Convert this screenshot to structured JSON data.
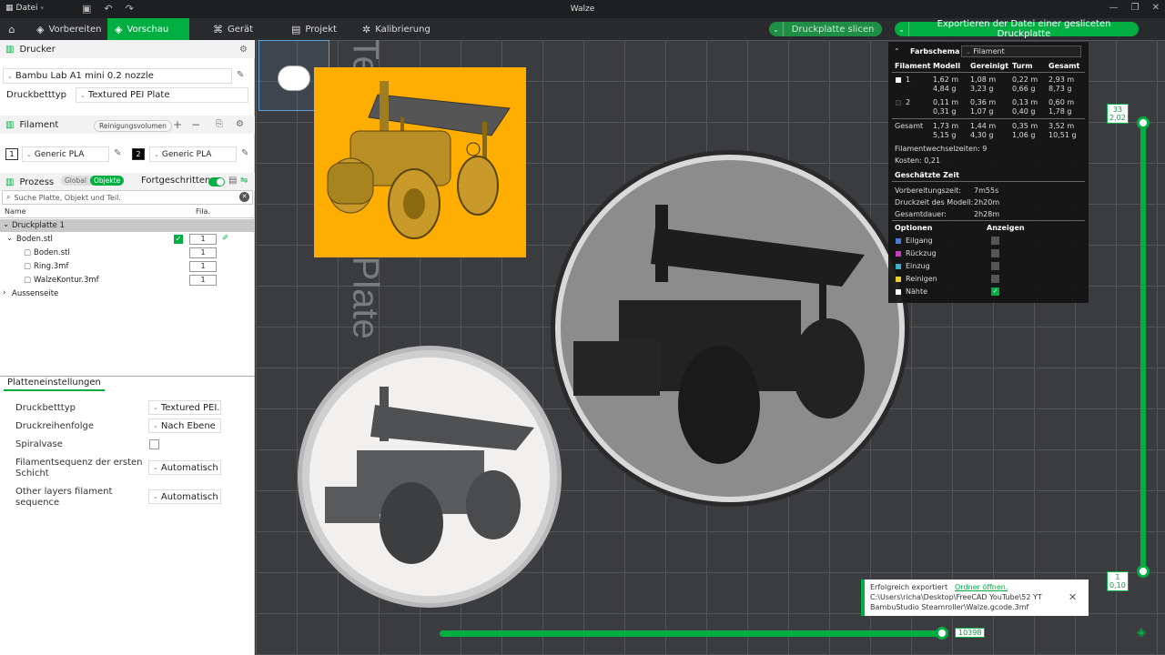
{
  "titlebar": {
    "file_menu": "Datei",
    "title": "Walze"
  },
  "toolbar": {
    "tabs": [
      {
        "label": "Vorbereiten"
      },
      {
        "label": "Vorschau"
      },
      {
        "label": "Gerät"
      },
      {
        "label": "Projekt"
      },
      {
        "label": "Kalibrierung"
      }
    ],
    "slice_label": "Druckplatte slicen",
    "export_label": "Exportieren der Datei einer gesliceten Druckplatte"
  },
  "printer": {
    "section": "Drucker",
    "model": "Bambu Lab A1 mini 0.2 nozzle",
    "bed_label": "Druckbetttyp",
    "bed_value": "Textured PEI Plate"
  },
  "filament": {
    "section": "Filament",
    "purge_button": "Reinigungsvolumen",
    "slots": [
      {
        "num": "1",
        "name": "Generic PLA"
      },
      {
        "num": "2",
        "name": "Generic PLA"
      }
    ]
  },
  "process": {
    "section": "Prozess",
    "global": "Global",
    "objects": "Objekte",
    "advanced": "Fortgeschritten"
  },
  "search": {
    "placeholder": "Suche Platte, Objekt und Teil."
  },
  "tree": {
    "col_name": "Name",
    "col_fila": "Fila.",
    "plate": "Druckplatte 1",
    "object": "Boden.stl",
    "object_fila": "1",
    "parts": [
      {
        "name": "Boden.stl",
        "fila": "1"
      },
      {
        "name": "Ring.3mf",
        "fila": "1"
      },
      {
        "name": "WalzeKontur.3mf",
        "fila": "1"
      }
    ],
    "other": "Aussenseite"
  },
  "plate_settings": {
    "tab": "Platteneinstellungen",
    "rows": [
      {
        "label": "Druckbetttyp",
        "value": "Textured PEI..."
      },
      {
        "label": "Druckreihenfolge",
        "value": "Nach Ebene"
      },
      {
        "label": "Spiralvase",
        "value": ""
      },
      {
        "label": "Filamentsequenz der ersten Schicht",
        "value": "Automatisch"
      },
      {
        "label": "Other layers filament sequence",
        "value": "Automatisch"
      }
    ]
  },
  "viewport": {
    "bed_text": "Textured PEI Plate"
  },
  "stats": {
    "scheme_label": "Farbschema",
    "scheme_value": "Filament",
    "headers": [
      "Filament",
      "Modell",
      "Gereinigt",
      "Turm",
      "Gesamt"
    ],
    "rows": [
      {
        "id": "1",
        "color": "#ffffff",
        "modell": [
          "1,62 m",
          "4,84 g"
        ],
        "gereinigt": [
          "1,08 m",
          "3,23 g"
        ],
        "turm": [
          "0,22 m",
          "0,66 g"
        ],
        "gesamt": [
          "2,93 m",
          "8,73 g"
        ]
      },
      {
        "id": "2",
        "color": "#222222",
        "modell": [
          "0,11 m",
          "0,31 g"
        ],
        "gereinigt": [
          "0,36 m",
          "1,07 g"
        ],
        "turm": [
          "0,13 m",
          "0,40 g"
        ],
        "gesamt": [
          "0,60 m",
          "1,78 g"
        ]
      },
      {
        "id": "Gesamt",
        "color": "",
        "modell": [
          "1,73 m",
          "5,15 g"
        ],
        "gereinigt": [
          "1,44 m",
          "4,30 g"
        ],
        "turm": [
          "0,35 m",
          "1,06 g"
        ],
        "gesamt": [
          "3,52 m",
          "10,51 g"
        ]
      }
    ],
    "changes": "Filamentwechselzeiten:  9",
    "cost": "Kosten:  0,21",
    "time_head": "Geschätzte Zeit",
    "times": [
      {
        "label": "Vorbereitungszeit:",
        "value": "7m55s"
      },
      {
        "label": "Druckzeit des Modell:",
        "value": "2h20m"
      },
      {
        "label": "Gesamtdauer:",
        "value": "2h28m"
      }
    ],
    "opt_head": "Optionen",
    "show_head": "Anzeigen",
    "options": [
      {
        "label": "Eilgang",
        "color": "#4a7bd0",
        "checked": false
      },
      {
        "label": "Rückzug",
        "color": "#c040c0",
        "checked": false
      },
      {
        "label": "Einzug",
        "color": "#3ab0d0",
        "checked": false
      },
      {
        "label": "Reinigen",
        "color": "#e8d030",
        "checked": false
      },
      {
        "label": "Nähte",
        "color": "#ffffff",
        "checked": true
      }
    ]
  },
  "vslider": {
    "top_layer": "33",
    "top_height": "2,02",
    "bottom_layer": "1",
    "bottom_height": "0,10"
  },
  "hslider": {
    "value": "10398"
  },
  "toast": {
    "status": "Erfolgreich exportiert",
    "open_link": "Ordner öffnen.",
    "path1": "C:\\Users\\richa\\Desktop\\FreeCAD YouTube\\52 YT",
    "path2": "BambuStudio Steamroller\\Walze.gcode.3mf"
  }
}
